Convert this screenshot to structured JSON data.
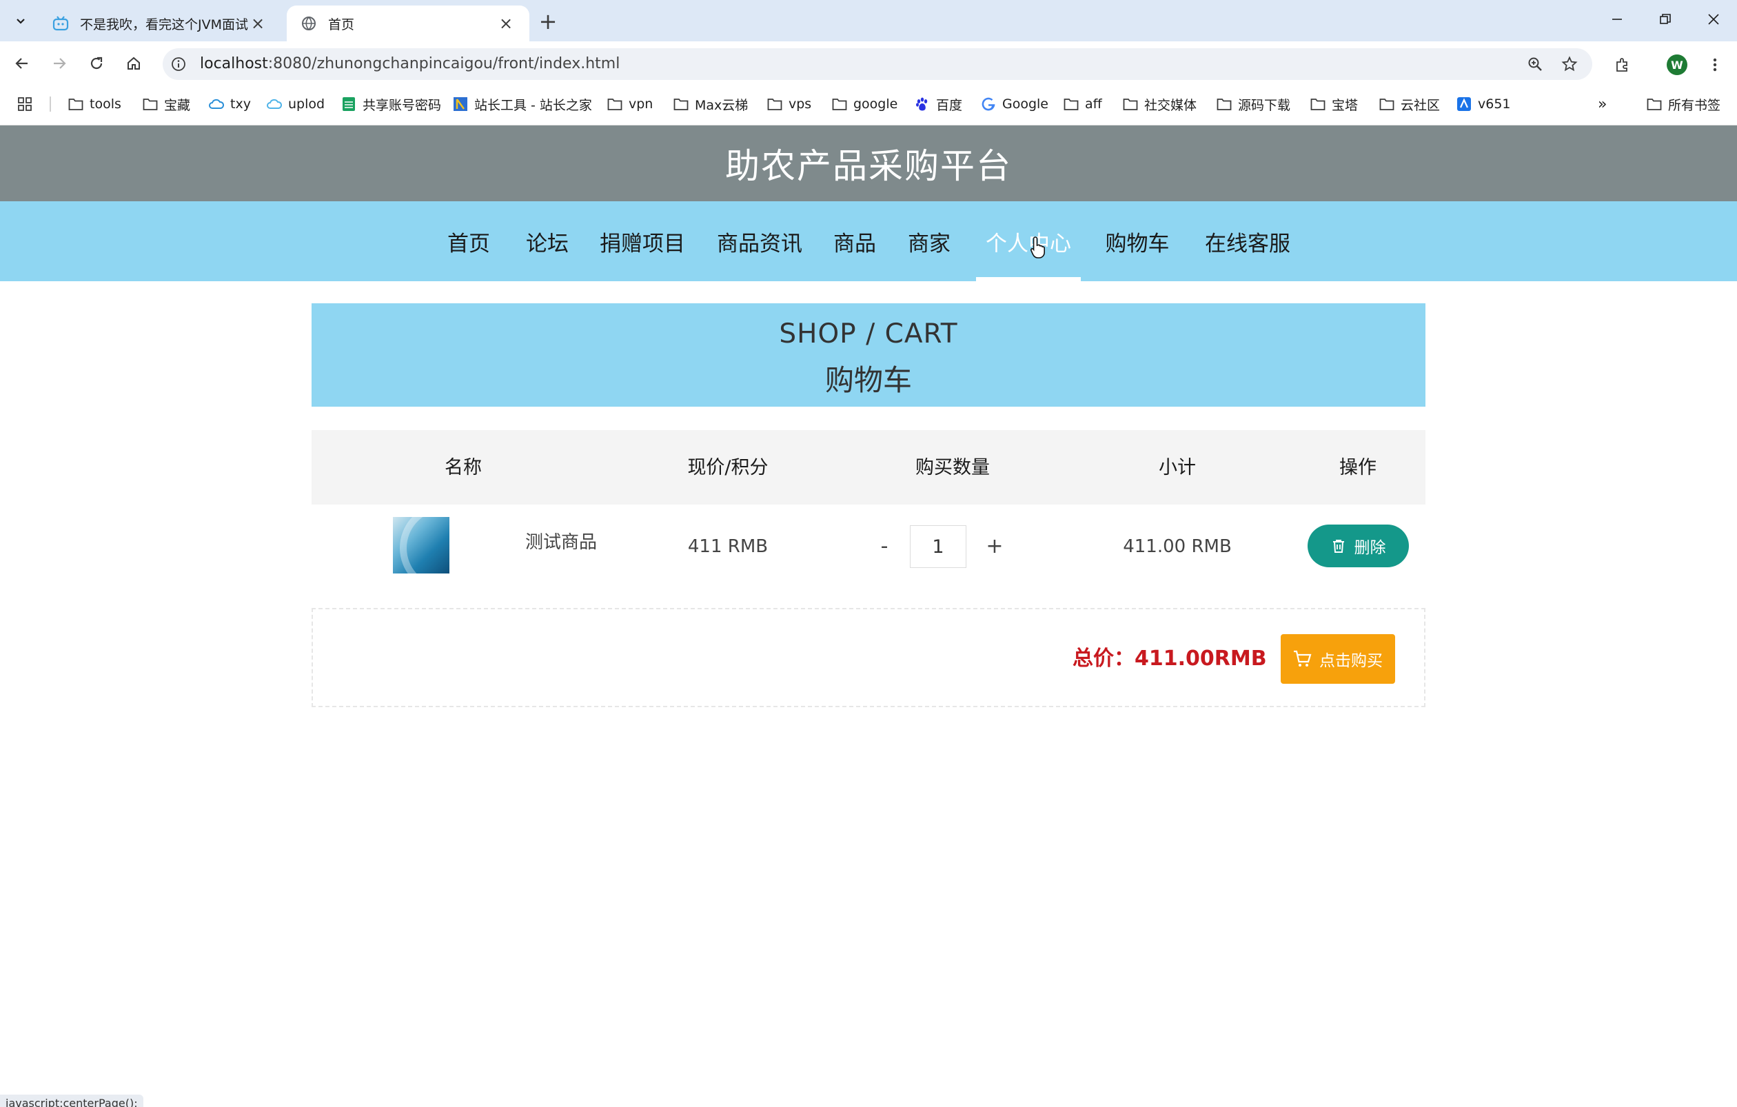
{
  "browser": {
    "tabs": [
      {
        "title": "不是我吹，看完这个JVM面试题",
        "active": false
      },
      {
        "title": "首页",
        "active": true
      }
    ],
    "url_host": "localhost",
    "url_path": ":8080/zhunongchanpincaigou/front/index.html",
    "profile_initial": "W",
    "bookmarks": [
      {
        "label": "tools",
        "icon": "folder-icon"
      },
      {
        "label": "宝藏",
        "icon": "folder-icon"
      },
      {
        "label": "txy",
        "icon": "cloud-icon"
      },
      {
        "label": "uplod",
        "icon": "cloud-icon"
      },
      {
        "label": "共享账号密码",
        "icon": "sheet-icon"
      },
      {
        "label": "站长工具 - 站长之家",
        "icon": "site-icon"
      },
      {
        "label": "vpn",
        "icon": "folder-icon"
      },
      {
        "label": "Max云梯",
        "icon": "folder-icon"
      },
      {
        "label": "vps",
        "icon": "folder-icon"
      },
      {
        "label": "google",
        "icon": "folder-icon"
      },
      {
        "label": "百度",
        "icon": "baidu-icon"
      },
      {
        "label": "Google",
        "icon": "google-icon"
      },
      {
        "label": "aff",
        "icon": "folder-icon"
      },
      {
        "label": "社交媒体",
        "icon": "folder-icon"
      },
      {
        "label": "源码下载",
        "icon": "folder-icon"
      },
      {
        "label": "宝塔",
        "icon": "folder-icon"
      },
      {
        "label": "云社区",
        "icon": "folder-icon"
      },
      {
        "label": "v651",
        "icon": "v-icon"
      }
    ],
    "all_bookmarks": "所有书签",
    "status_text": "javascript:centerPage();"
  },
  "site": {
    "title": "助农产品采购平台",
    "nav": [
      "首页",
      "论坛",
      "捐赠项目",
      "商品资讯",
      "商品",
      "商家",
      "个人中心",
      "购物车",
      "在线客服"
    ],
    "active_nav": "个人中心"
  },
  "cart": {
    "banner_en": "SHOP / CART",
    "banner_cn": "购物车",
    "headers": {
      "name": "名称",
      "price": "现价/积分",
      "quantity": "购买数量",
      "subtotal": "小计",
      "action": "操作"
    },
    "items": [
      {
        "name": "测试商品",
        "price": "411 RMB",
        "quantity": "1",
        "subtotal": "411.00 RMB"
      }
    ],
    "minus": "-",
    "plus": "+",
    "delete_label": "删除",
    "total": "总价：411.00RMB",
    "buy_label": "点击购买"
  },
  "colors": {
    "header_bg": "#7f8a8c",
    "nav_bg": "#8fd6f2",
    "delete_btn": "#14988a",
    "buy_btn": "#f7a10c",
    "total_text": "#c8191f"
  }
}
